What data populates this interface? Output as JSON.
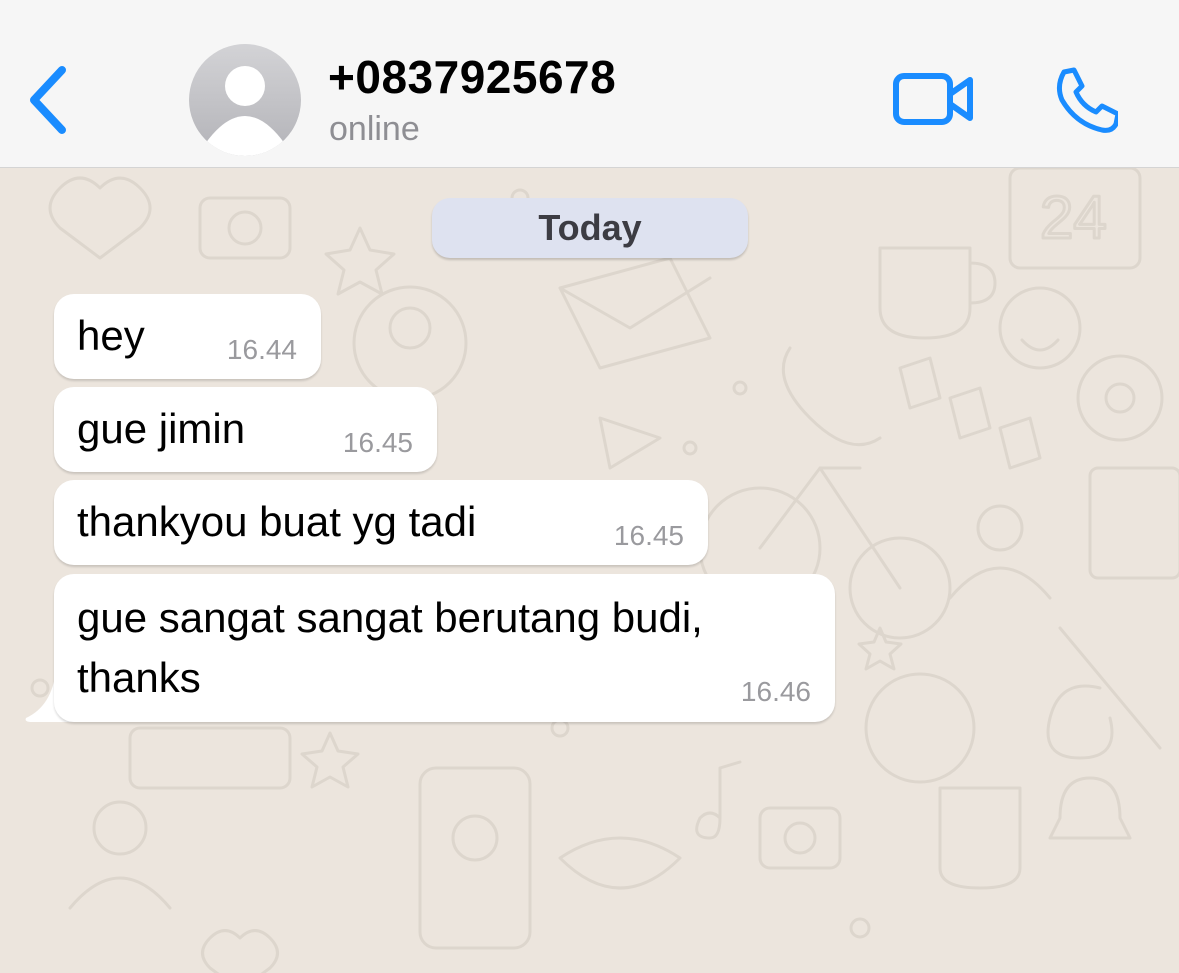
{
  "header": {
    "contact_name": "+0837925678",
    "status": "online",
    "icons": {
      "back": "chevron-left-icon",
      "avatar": "default-avatar-icon",
      "video": "video-camera-icon",
      "call": "phone-icon"
    },
    "accent_color": "#1A8CFF"
  },
  "chat": {
    "date_label": "Today",
    "messages": [
      {
        "text": "hey",
        "time": "16.44"
      },
      {
        "text": "gue jimin",
        "time": "16.45"
      },
      {
        "text": "thankyou buat yg tadi",
        "time": "16.45"
      },
      {
        "text": "gue sangat sangat berutang budi, thanks",
        "time": "16.46"
      }
    ]
  },
  "colors": {
    "wallpaper": "#ECE5DD",
    "header_bg": "#F6F6F6",
    "incoming_bubble": "#FFFFFF",
    "date_chip": "#DEE2F0"
  }
}
